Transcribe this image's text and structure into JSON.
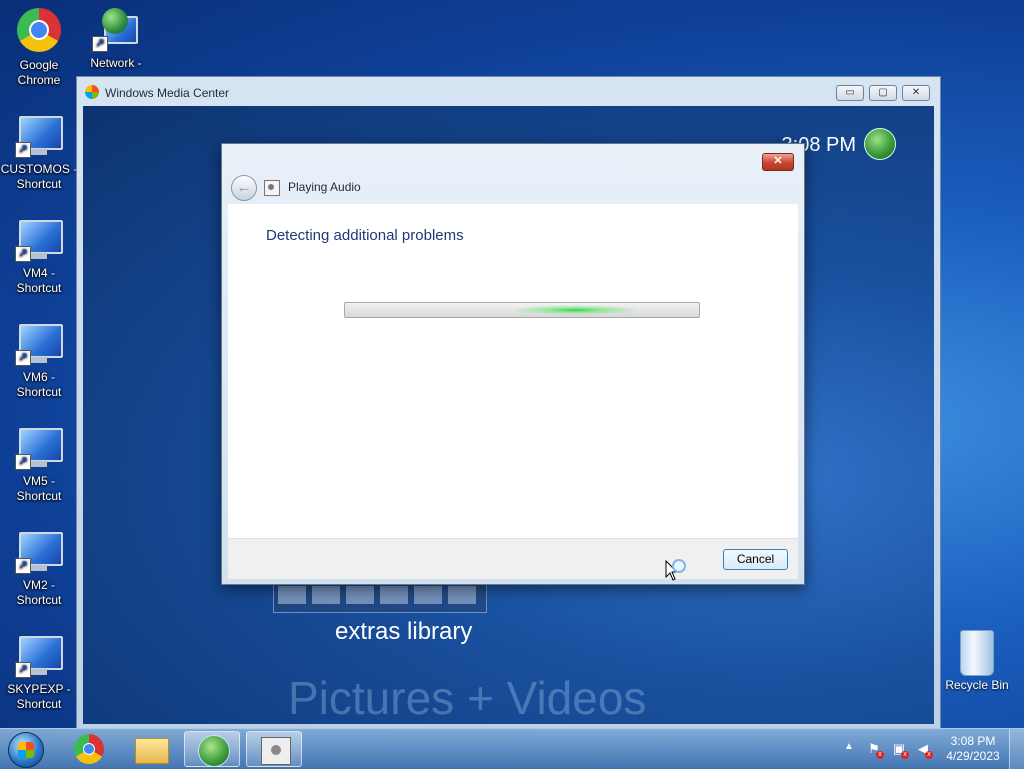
{
  "desktop": {
    "icons": [
      {
        "label_line1": "Google",
        "label_line2": "Chrome"
      },
      {
        "label_line1": "Network -",
        "label_line2": ""
      },
      {
        "label_line1": "CUSTOMOS -",
        "label_line2": "Shortcut"
      },
      {
        "label_line1": "VM4 -",
        "label_line2": "Shortcut"
      },
      {
        "label_line1": "VM6 -",
        "label_line2": "Shortcut"
      },
      {
        "label_line1": "VM5 -",
        "label_line2": "Shortcut"
      },
      {
        "label_line1": "VM2 -",
        "label_line2": "Shortcut"
      },
      {
        "label_line1": "SKYPEXP -",
        "label_line2": "Shortcut"
      }
    ],
    "recycle_bin_label": "Recycle Bin"
  },
  "media_center": {
    "title": "Windows Media Center",
    "clock": "3:08 PM",
    "extras_label": "extras library",
    "pictures_label": "Pictures + Videos"
  },
  "dialog": {
    "heading": "Playing Audio",
    "status_text": "Detecting additional problems",
    "cancel_label": "Cancel",
    "close_symbol": "✕",
    "back_symbol": "←",
    "progress_mode": "indeterminate"
  },
  "taskbar": {
    "clock_time": "3:08 PM",
    "clock_date": "4/29/2023",
    "tray_arrow": "▲"
  },
  "colors": {
    "accent": "#1d3a78",
    "progress_glow": "#28d23c"
  }
}
